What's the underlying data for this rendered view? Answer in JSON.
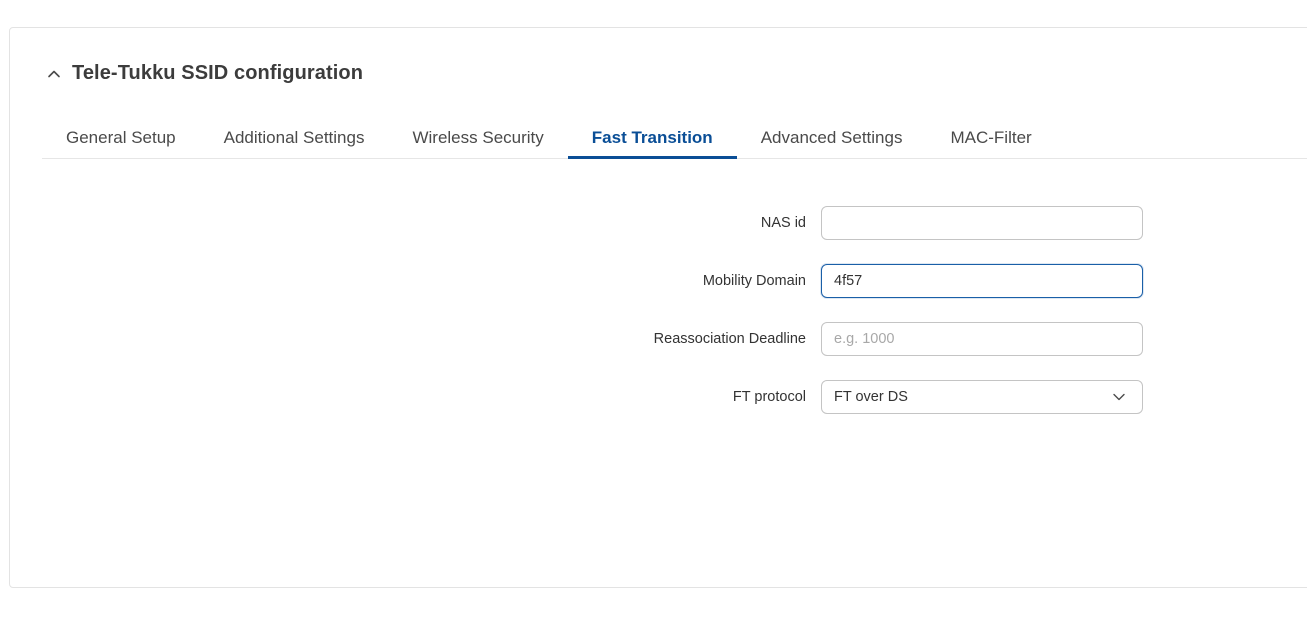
{
  "panel": {
    "title": "Tele-Tukku SSID configuration"
  },
  "tabs": [
    {
      "label": "General Setup",
      "active": false
    },
    {
      "label": "Additional Settings",
      "active": false
    },
    {
      "label": "Wireless Security",
      "active": false
    },
    {
      "label": "Fast Transition",
      "active": true
    },
    {
      "label": "Advanced Settings",
      "active": false
    },
    {
      "label": "MAC-Filter",
      "active": false
    }
  ],
  "form": {
    "nas_id": {
      "label": "NAS id",
      "value": "",
      "placeholder": ""
    },
    "mobility_domain": {
      "label": "Mobility Domain",
      "value": "4f57",
      "placeholder": ""
    },
    "reassociation_deadline": {
      "label": "Reassociation Deadline",
      "value": "",
      "placeholder": "e.g. 1000"
    },
    "ft_protocol": {
      "label": "FT protocol",
      "selected": "FT over DS"
    }
  },
  "colors": {
    "accent": "#0a4e96",
    "border": "#c4c4c4",
    "focus_border": "#1a5fa8"
  },
  "icons": {
    "collapse": "chevron-up-icon",
    "dropdown": "chevron-down-icon"
  }
}
